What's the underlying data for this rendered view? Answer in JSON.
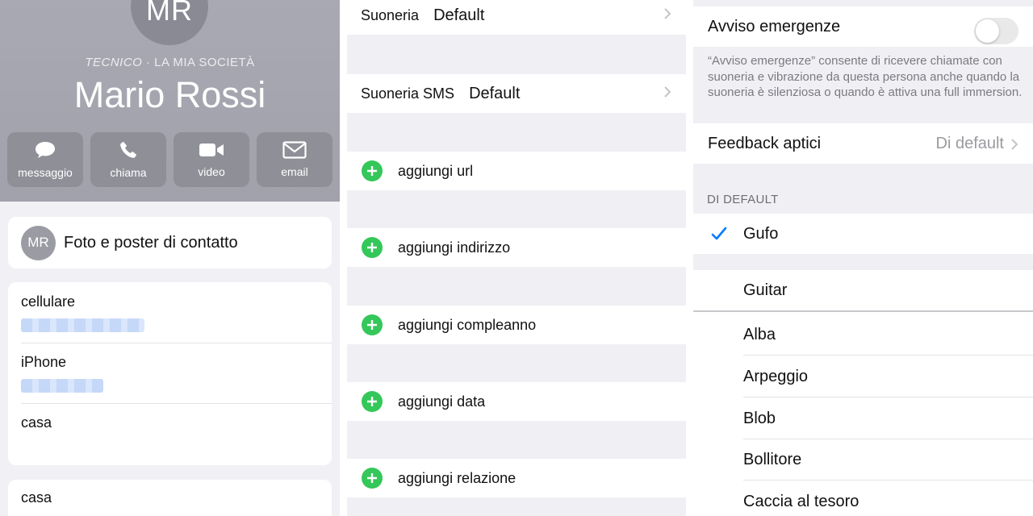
{
  "contact": {
    "initials": "MR",
    "job_title": "TECNICO",
    "company": " · LA MIA SOCIETÀ",
    "name": "Mario Rossi",
    "actions": [
      {
        "label": "messaggio",
        "icon": "message-icon"
      },
      {
        "label": "chiama",
        "icon": "phone-icon"
      },
      {
        "label": "video",
        "icon": "video-icon"
      },
      {
        "label": "email",
        "icon": "email-icon"
      }
    ],
    "photo_poster_label": "Foto e poster di contatto",
    "phones": [
      {
        "label": "cellulare"
      },
      {
        "label": "iPhone"
      },
      {
        "label": "casa"
      }
    ],
    "extra_label": "casa"
  },
  "ringtones": {
    "ringtone_label": "Suoneria",
    "ringtone_value": "Default",
    "sms_label": "Suoneria SMS",
    "sms_value": "Default"
  },
  "add_fields": [
    "aggiungi url",
    "aggiungi indirizzo",
    "aggiungi compleanno",
    "aggiungi data",
    "aggiungi relazione"
  ],
  "settings": {
    "emergency_label": "Avviso emergenze",
    "emergency_on": false,
    "emergency_note": "“Avviso emergenze” consente di ricevere chiamate con suoneria e vibrazione da questa persona anche quando la suoneria è silenziosa o quando è attiva una full immersion.",
    "haptic_label": "Feedback aptici",
    "haptic_value": "Di default",
    "section_header": "DI DEFAULT",
    "selected_tone": "Gufo",
    "tones": [
      "Guitar",
      "Alba",
      "Arpeggio",
      "Blob",
      "Bollitore",
      "Caccia al tesoro"
    ]
  },
  "colors": {
    "accent_blue": "#007aff",
    "add_green": "#34c759",
    "header_gray": "#a5a5ae"
  }
}
